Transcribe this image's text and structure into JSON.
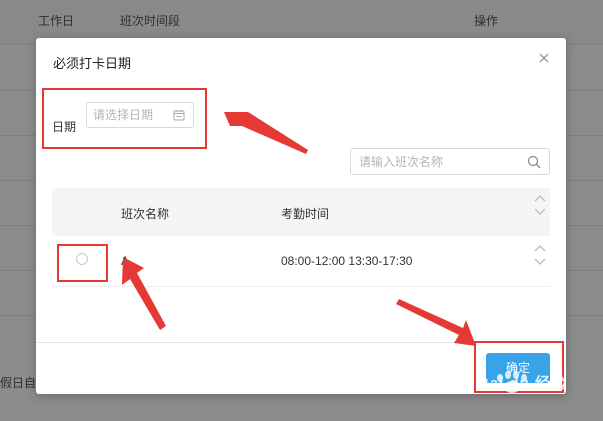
{
  "background": {
    "columns": [
      "工作日",
      "班次时间段",
      "操作"
    ],
    "bottom_text": "假日自"
  },
  "dialog": {
    "title": "必须打卡日期",
    "date_label": "日期",
    "date_placeholder": "请选择日期",
    "search_placeholder": "请输入班次名称",
    "table": {
      "headers": [
        "班次名称",
        "考勤时间"
      ],
      "rows": [
        {
          "name": "A",
          "time": "08:00-12:00 13:30-17:30"
        }
      ]
    },
    "confirm_label": "确定"
  },
  "watermark": "Bai du 经验",
  "colors": {
    "primary": "#39a3ea",
    "annotation": "#e53935"
  }
}
